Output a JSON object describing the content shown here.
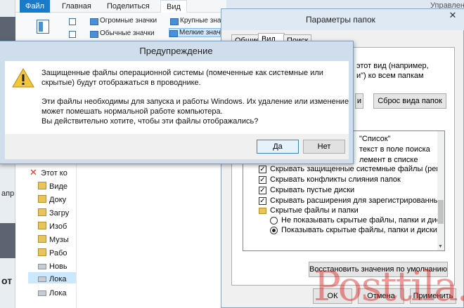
{
  "explorer": {
    "tabs": {
      "file": "Файл",
      "home": "Главная",
      "share": "Поделиться",
      "view": "Вид",
      "manage": "Управление"
    },
    "left_labels": {
      "top": "апр",
      "bottom": "от"
    },
    "view_options": [
      {
        "label": "Огромные значки"
      },
      {
        "label": "Крупные знач"
      },
      {
        "label": "Обычные значки"
      },
      {
        "label": "Мелкие знач"
      }
    ],
    "nav_items": [
      {
        "label": "Этот ко",
        "icon": "this-pc-icon"
      },
      {
        "label": "Виде",
        "icon": "folder-icon"
      },
      {
        "label": "Доку",
        "icon": "folder-icon"
      },
      {
        "label": "Загру",
        "icon": "folder-icon"
      },
      {
        "label": "Изоб",
        "icon": "folder-icon"
      },
      {
        "label": "Музы",
        "icon": "folder-icon"
      },
      {
        "label": "Рабо",
        "icon": "folder-icon"
      },
      {
        "label": "Новь",
        "icon": "drive-icon"
      },
      {
        "label": "Лока",
        "icon": "drive-icon"
      },
      {
        "label": "Лока",
        "icon": "drive-icon"
      }
    ]
  },
  "folder_options": {
    "title": "Параметры папок",
    "close": "✕",
    "tabs": [
      "Общие",
      "Вид",
      "Поиск"
    ],
    "apply_text": [
      "этот вид (например,",
      "и\") ко всем папкам"
    ],
    "reset_button": "Сброс вида папок",
    "apply_button_partial": "и",
    "advanced": [
      {
        "type": "text",
        "label": "\"Список\""
      },
      {
        "type": "text",
        "label": "текст в поле поиска"
      },
      {
        "type": "text",
        "label": "лемент в списке"
      },
      {
        "type": "checkbox",
        "checked": true,
        "label": "Скрывать защищенные системные файлы (рекомен"
      },
      {
        "type": "checkbox",
        "checked": true,
        "label": "Скрывать конфликты слияния папок"
      },
      {
        "type": "checkbox",
        "checked": true,
        "label": "Скрывать пустые диски"
      },
      {
        "type": "checkbox",
        "checked": true,
        "label": "Скрывать расширения для зарегистрированных типо"
      },
      {
        "type": "folder",
        "label": "Скрытые файлы и папки"
      },
      {
        "type": "radio",
        "checked": false,
        "label": "Не показывать скрытые файлы, папки и диски"
      },
      {
        "type": "radio",
        "checked": true,
        "label": "Показывать скрытые файлы, папки и диски"
      }
    ],
    "restore_defaults": "Восстановить значения по умолчанию",
    "ok": "ОК",
    "cancel": "Отмена",
    "apply": "Применить"
  },
  "warning": {
    "title": "Предупреждение",
    "line1": "Защищенные файлы операционной системы (помеченные как системные или",
    "line2": "скрытые) будут отображаться в проводнике.",
    "line3": "Эти файлы необходимы для запуска и работы Windows. Их удаление или изменение",
    "line4": "может помешать нормальной работе компьютера.",
    "line5": "Вы действительно хотите, чтобы  эти файлы отображались?",
    "yes": "Да",
    "no": "Нет",
    "icon": "warning-icon"
  },
  "watermark": "Posttila.ru",
  "colors": {
    "file_tab": "#1979ca",
    "nav_selection": "#cce8ff",
    "watermark": "#d71919"
  }
}
